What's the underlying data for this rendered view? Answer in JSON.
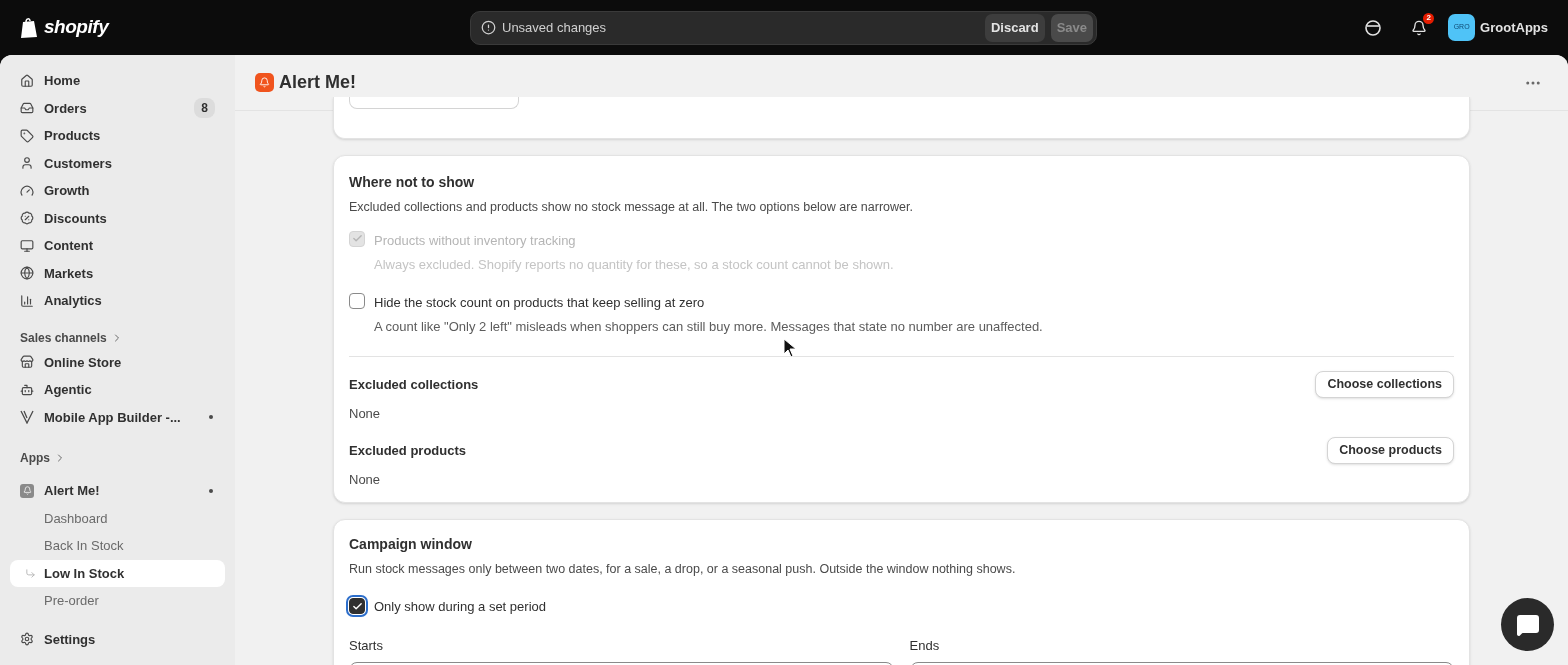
{
  "top_bar": {
    "logo_text": "shopify",
    "unsaved": {
      "message": "Unsaved changes",
      "buttons": [
        {
          "label": "Discard",
          "disabled": false
        },
        {
          "label": "Save",
          "disabled": true
        }
      ]
    },
    "notifications_badge": "2",
    "avatar_initials": "GRO",
    "store_name": "GrootApps"
  },
  "sidebar": {
    "items": [
      {
        "label": "Home",
        "selected": false
      },
      {
        "label": "Orders",
        "badge": "8",
        "selected": false
      },
      {
        "label": "Products",
        "selected": false
      },
      {
        "label": "Customers",
        "selected": false
      },
      {
        "label": "Growth",
        "selected": false
      },
      {
        "label": "Discounts",
        "selected": false
      },
      {
        "label": "Content",
        "selected": false
      },
      {
        "label": "Markets",
        "selected": false
      },
      {
        "label": "Analytics",
        "selected": false
      }
    ],
    "sales_channels": {
      "heading": "Sales channels",
      "items": [
        {
          "label": "Online Store",
          "dot": false
        },
        {
          "label": "Agentic",
          "dot": false
        },
        {
          "label": "Mobile App Builder -...",
          "dot": true
        }
      ]
    },
    "apps": {
      "heading": "Apps",
      "app": {
        "label": "Alert Me!",
        "dot": true
      },
      "children": [
        {
          "label": "Dashboard",
          "selected": false
        },
        {
          "label": "Back In Stock",
          "selected": false
        },
        {
          "label": "Low In Stock",
          "selected": true
        },
        {
          "label": "Pre-order",
          "selected": false
        }
      ]
    },
    "settings": "Settings"
  },
  "page": {
    "title": "Alert Me!"
  },
  "where_not_to_show": {
    "title": "Where not to show",
    "description": "Excluded collections and products show no stock message at all. The two options below are narrower.",
    "options": [
      {
        "label": "Products without inventory tracking",
        "help": "Always excluded. Shopify reports no quantity for these, so a stock count cannot be shown.",
        "checked": true,
        "disabled": true
      },
      {
        "label": "Hide the stock count on products that keep selling at zero",
        "help": "A count like \"Only 2 left\" misleads when shoppers can still buy more. Messages that state no number are unaffected.",
        "checked": false,
        "disabled": false
      }
    ],
    "excluded": [
      {
        "label": "Excluded collections",
        "value": "None",
        "button": "Choose collections"
      },
      {
        "label": "Excluded products",
        "value": "None",
        "button": "Choose products"
      }
    ]
  },
  "campaign_window": {
    "title": "Campaign window",
    "description": "Run stock messages only between two dates, for a sale, a drop, or a seasonal push. Outside the window nothing shows.",
    "option": {
      "label": "Only show during a set period",
      "checked": true
    },
    "fields": [
      {
        "label": "Starts"
      },
      {
        "label": "Ends"
      }
    ]
  }
}
